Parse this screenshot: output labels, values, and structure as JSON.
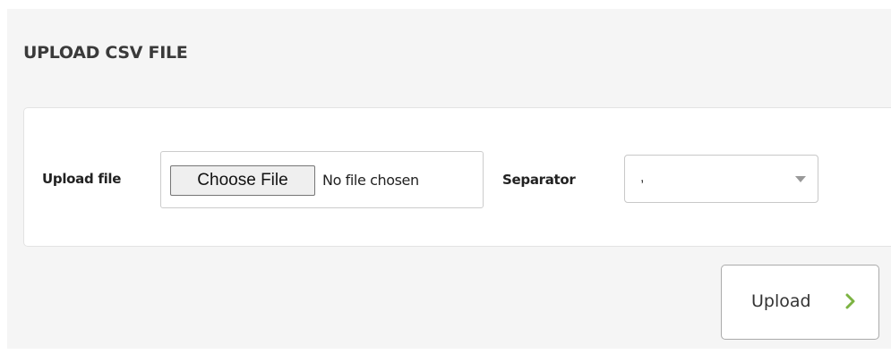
{
  "page": {
    "title": "UPLOAD CSV FILE"
  },
  "form": {
    "upload_file_label": "Upload file",
    "choose_file_button": "Choose File",
    "file_status": "No file chosen",
    "separator_label": "Separator",
    "separator_value": ","
  },
  "actions": {
    "upload_label": "Upload"
  },
  "icons": {
    "select_arrow": "caret-down-icon",
    "upload_chevron": "chevron-right-icon"
  },
  "colors": {
    "accent": "#7cb342",
    "panel_background": "#f5f5f5"
  }
}
